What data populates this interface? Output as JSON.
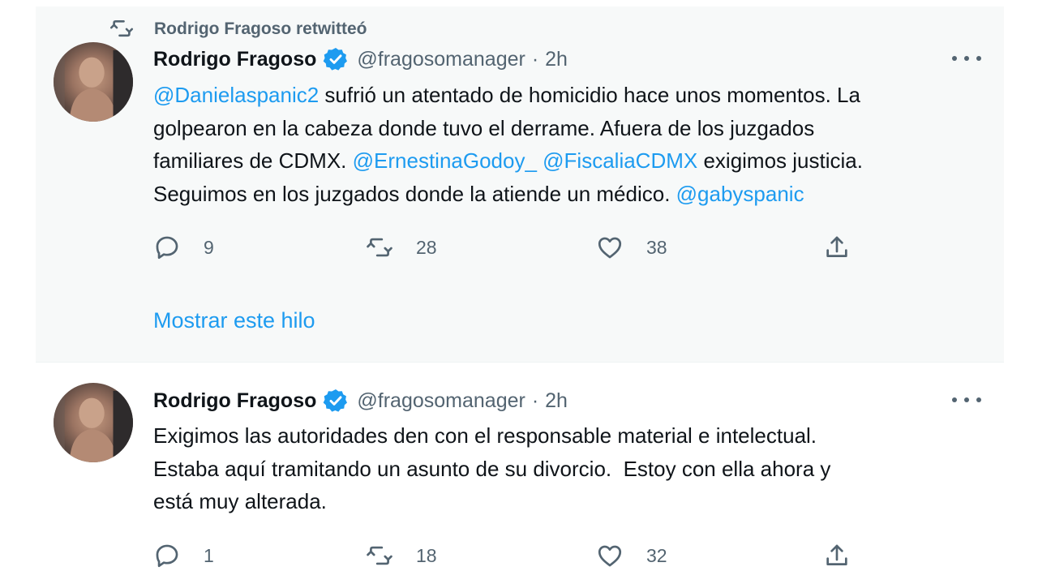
{
  "retweet_banner": {
    "text": "Rodrigo Fragoso retwitteó"
  },
  "tweets": [
    {
      "author": {
        "display_name": "Rodrigo Fragoso",
        "handle": "@fragosomanager",
        "time": "2h"
      },
      "separator": "·",
      "lines": [
        [
          {
            "t": "@Danielaspanic2",
            "m": true
          },
          {
            "t": " sufrió un atentado de homicidio hace unos momentos. La",
            "m": false
          }
        ],
        [
          {
            "t": "golpearon en la cabeza donde tuvo el derrame. Afuera de los juzgados",
            "m": false
          }
        ],
        [
          {
            "t": "familiares de CDMX. ",
            "m": false
          },
          {
            "t": "@ErnestinaGodoy_",
            "m": true
          },
          {
            "t": " ",
            "m": false
          },
          {
            "t": "@FiscaliaCDMX",
            "m": true
          },
          {
            "t": " exigimos justicia.",
            "m": false
          }
        ],
        [
          {
            "t": "Seguimos en los juzgados donde la atiende un médico. ",
            "m": false
          },
          {
            "t": "@gabyspanic",
            "m": true
          }
        ]
      ],
      "stats": {
        "replies": "9",
        "retweets": "28",
        "likes": "38"
      },
      "show_thread": "Mostrar este hilo"
    },
    {
      "author": {
        "display_name": "Rodrigo Fragoso",
        "handle": "@fragosomanager",
        "time": "2h"
      },
      "separator": "·",
      "lines": [
        [
          {
            "t": "Exigimos las autoridades den con el responsable material e intelectual.",
            "m": false
          }
        ],
        [
          {
            "t": "Estaba aquí tramitando un asunto de su divorcio.  Estoy con ella ahora y",
            "m": false
          }
        ],
        [
          {
            "t": "está muy alterada.",
            "m": false
          }
        ]
      ],
      "stats": {
        "replies": "1",
        "retweets": "18",
        "likes": "32"
      }
    }
  ],
  "colors": {
    "accent": "#1d9bf0",
    "secondary_text": "#536471",
    "primary_text": "#0f1419",
    "highlight_bg": "#f7f9f9"
  },
  "icons": [
    "retweet-icon",
    "verified-badge-icon",
    "more-icon",
    "reply-icon",
    "like-icon",
    "share-icon"
  ]
}
